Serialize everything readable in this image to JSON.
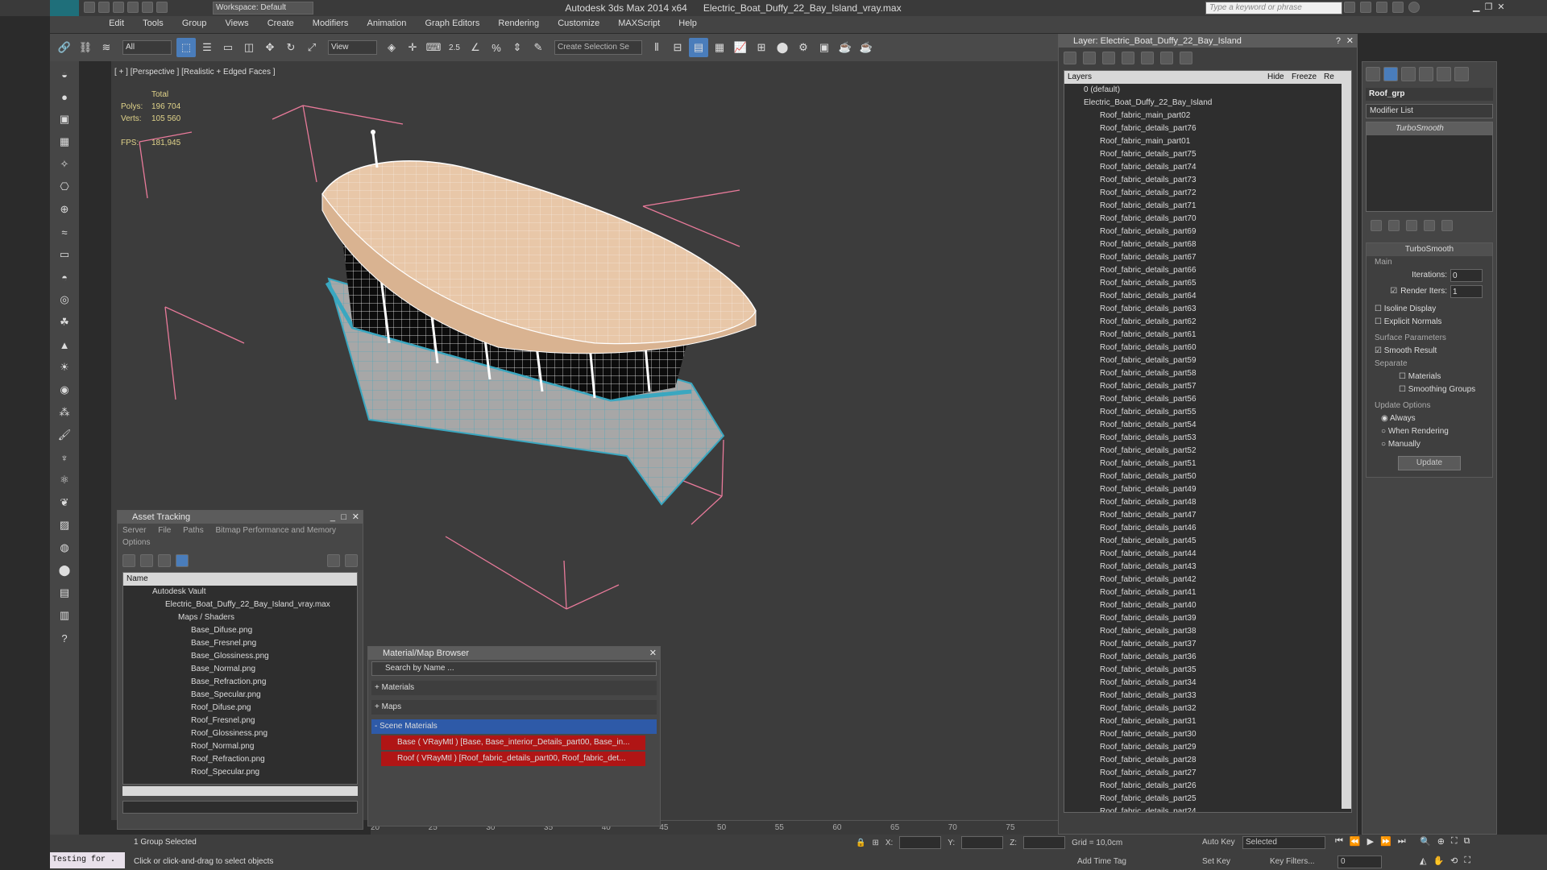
{
  "app": {
    "title": "Autodesk 3ds Max 2014 x64",
    "file": "Electric_Boat_Duffy_22_Bay_Island_vray.max",
    "workspace": "Workspace: Default",
    "search_placeholder": "Type a keyword or phrase"
  },
  "menu": [
    "Edit",
    "Tools",
    "Group",
    "Views",
    "Create",
    "Modifiers",
    "Animation",
    "Graph Editors",
    "Rendering",
    "Customize",
    "MAXScript",
    "Help"
  ],
  "toolbar": {
    "filter": "All",
    "view": "View",
    "create_selection": "Create Selection Se",
    "snap_value": "2.5"
  },
  "viewport": {
    "label": "[ + ] [Perspective ] [Realistic + Edged Faces ]",
    "total_label": "Total",
    "polys_label": "Polys:",
    "polys": "196 704",
    "verts_label": "Verts:",
    "verts": "105 560",
    "fps_label": "FPS:",
    "fps": "181,945"
  },
  "layer_panel": {
    "title": "Layer: Electric_Boat_Duffy_22_Bay_Island",
    "col_layers": "Layers",
    "col_hide": "Hide",
    "col_freeze": "Freeze",
    "col_re": "Re",
    "default_layer": "0 (default)",
    "main_layer": "Electric_Boat_Duffy_22_Bay_Island",
    "items": [
      "Roof_fabric_main_part02",
      "Roof_fabric_details_part76",
      "Roof_fabric_main_part01",
      "Roof_fabric_details_part75",
      "Roof_fabric_details_part74",
      "Roof_fabric_details_part73",
      "Roof_fabric_details_part72",
      "Roof_fabric_details_part71",
      "Roof_fabric_details_part70",
      "Roof_fabric_details_part69",
      "Roof_fabric_details_part68",
      "Roof_fabric_details_part67",
      "Roof_fabric_details_part66",
      "Roof_fabric_details_part65",
      "Roof_fabric_details_part64",
      "Roof_fabric_details_part63",
      "Roof_fabric_details_part62",
      "Roof_fabric_details_part61",
      "Roof_fabric_details_part60",
      "Roof_fabric_details_part59",
      "Roof_fabric_details_part58",
      "Roof_fabric_details_part57",
      "Roof_fabric_details_part56",
      "Roof_fabric_details_part55",
      "Roof_fabric_details_part54",
      "Roof_fabric_details_part53",
      "Roof_fabric_details_part52",
      "Roof_fabric_details_part51",
      "Roof_fabric_details_part50",
      "Roof_fabric_details_part49",
      "Roof_fabric_details_part48",
      "Roof_fabric_details_part47",
      "Roof_fabric_details_part46",
      "Roof_fabric_details_part45",
      "Roof_fabric_details_part44",
      "Roof_fabric_details_part43",
      "Roof_fabric_details_part42",
      "Roof_fabric_details_part41",
      "Roof_fabric_details_part40",
      "Roof_fabric_details_part39",
      "Roof_fabric_details_part38",
      "Roof_fabric_details_part37",
      "Roof_fabric_details_part36",
      "Roof_fabric_details_part35",
      "Roof_fabric_details_part34",
      "Roof_fabric_details_part33",
      "Roof_fabric_details_part32",
      "Roof_fabric_details_part31",
      "Roof_fabric_details_part30",
      "Roof_fabric_details_part29",
      "Roof_fabric_details_part28",
      "Roof_fabric_details_part27",
      "Roof_fabric_details_part26",
      "Roof_fabric_details_part25",
      "Roof_fabric_details_part24"
    ]
  },
  "cmd_panel": {
    "object_name": "Roof_grp",
    "modifier_list": "Modifier List",
    "modifier": "TurboSmooth",
    "rollout": "TurboSmooth",
    "main": "Main",
    "iterations_label": "Iterations:",
    "iterations": "0",
    "render_iters_label": "Render Iters:",
    "render_iters": "1",
    "isoline": "Isoline Display",
    "explicit": "Explicit Normals",
    "surface": "Surface Parameters",
    "smooth": "Smooth Result",
    "separate": "Separate",
    "materials": "Materials",
    "smoothing": "Smoothing Groups",
    "update_options": "Update Options",
    "always": "Always",
    "when_rendering": "When Rendering",
    "manually": "Manually",
    "update": "Update"
  },
  "asset": {
    "title": "Asset Tracking",
    "menu": [
      "Server",
      "File",
      "Paths",
      "Bitmap Performance and Memory",
      "Options"
    ],
    "col_name": "Name",
    "vault": "Autodesk Vault",
    "file": "Electric_Boat_Duffy_22_Bay_Island_vray.max",
    "maps": "Maps / Shaders",
    "files": [
      "Base_Difuse.png",
      "Base_Fresnel.png",
      "Base_Glossiness.png",
      "Base_Normal.png",
      "Base_Refraction.png",
      "Base_Specular.png",
      "Roof_Difuse.png",
      "Roof_Fresnel.png",
      "Roof_Glossiness.png",
      "Roof_Normal.png",
      "Roof_Refraction.png",
      "Roof_Specular.png"
    ]
  },
  "matbrowser": {
    "title": "Material/Map Browser",
    "search": "Search by Name ...",
    "materials": "+ Materials",
    "maps": "+ Maps",
    "scene": "- Scene Materials",
    "mat1": "Base ( VRayMtl ) [Base, Base_interior_Details_part00, Base_in...",
    "mat2": "Roof ( VRayMtl ) [Roof_fabric_details_part00, Roof_fabric_det..."
  },
  "ruler": [
    "20",
    "25",
    "30",
    "35",
    "40",
    "45",
    "50",
    "55",
    "60",
    "65",
    "70",
    "75"
  ],
  "status": {
    "selection": "1 Group Selected",
    "prompt": "Click or click-and-drag to select objects",
    "x": "X:",
    "y": "Y:",
    "z": "Z:",
    "grid": "Grid = 10,0cm",
    "add_time_tag": "Add Time Tag",
    "auto_key": "Auto Key",
    "set_key": "Set Key",
    "selected": "Selected",
    "key_filters": "Key Filters...",
    "frame": "0",
    "listener": "Testing for ."
  }
}
